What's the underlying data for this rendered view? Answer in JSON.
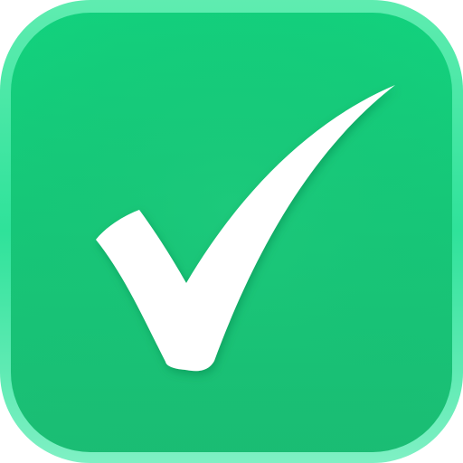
{
  "icon": {
    "name": "checkmark-icon",
    "colors": {
      "background_top": "#1fd98a",
      "background_bottom": "#16c075",
      "bezel_light": "#7ff0c4",
      "bezel_mid": "#2ee59b",
      "checkmark": "#ffffff",
      "shadow": "#0a7a47"
    }
  }
}
